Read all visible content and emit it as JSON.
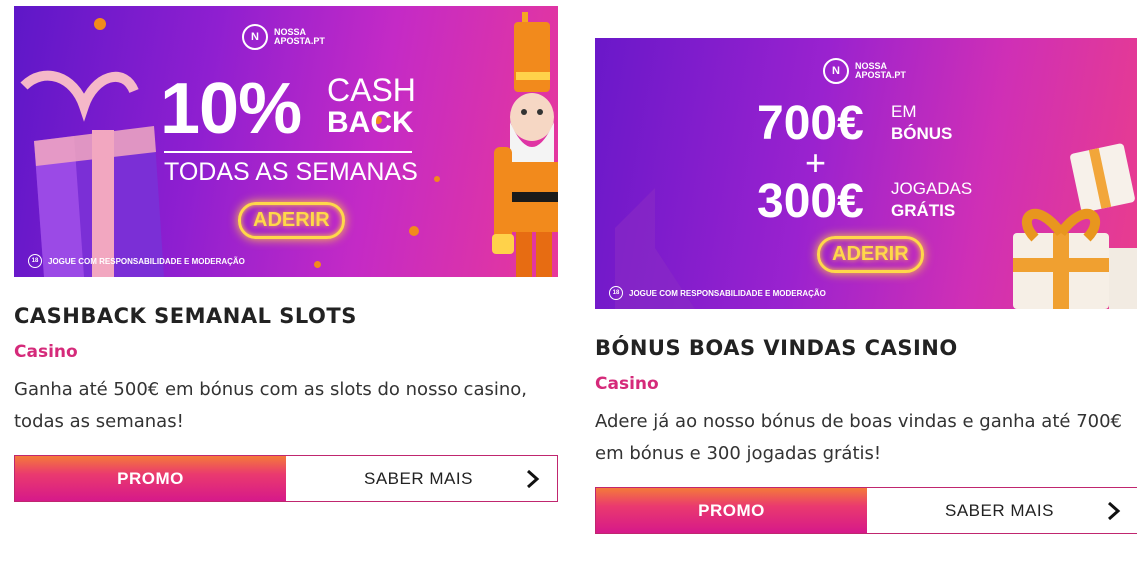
{
  "brand": {
    "name_line1": "NOSSA",
    "name_line2": "APOSTA.PT"
  },
  "responsible": "JOGUE COM RESPONSABILIDADE E MODERAÇÃO",
  "cards": [
    {
      "banner": {
        "big_number": "10%",
        "word1": "CASH",
        "word2": "BACK",
        "subtitle": "TODAS AS SEMANAS",
        "cta": "ADERIR"
      },
      "title": "CASHBACK SEMANAL SLOTS",
      "category": "Casino",
      "description": "Ganha até 500€ em bónus com as slots do nosso casino, todas as semanas!",
      "promo_label": "PROMO",
      "more_label": "SABER MAIS"
    },
    {
      "banner": {
        "amount1": "700€",
        "amount1_a": "EM",
        "amount1_b": "BÓNUS",
        "plus": "+",
        "amount2": "300€",
        "amount2_a": "JOGADAS",
        "amount2_b": "GRÁTIS",
        "cta": "ADERIR"
      },
      "title": "BÓNUS BOAS VINDAS CASINO",
      "category": "Casino",
      "description": "Adere já ao nosso bónus de boas vindas e ganha até 700€ em bónus e 300 jogadas grátis!",
      "promo_label": "PROMO",
      "more_label": "SABER MAIS"
    }
  ],
  "colors": {
    "accent": "#d52a7a",
    "cta_glow": "#ffd84a"
  }
}
